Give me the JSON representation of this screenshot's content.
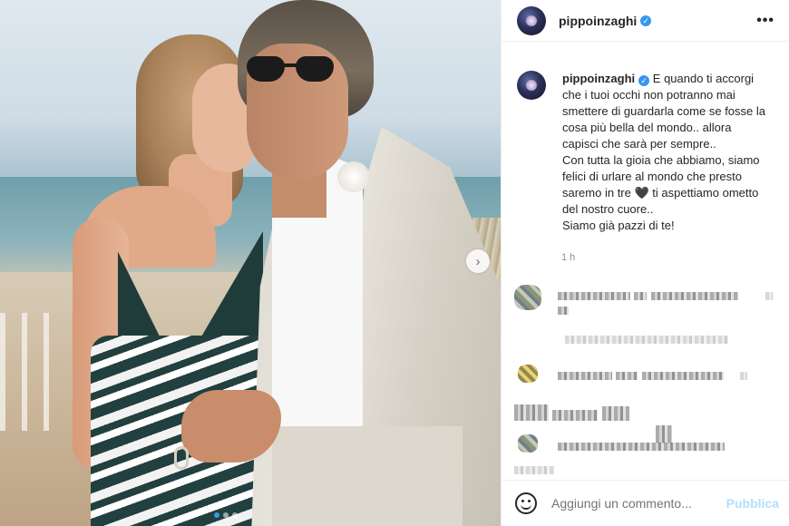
{
  "post": {
    "username": "pippoinzaghi",
    "verified_icon": "verified-badge-icon",
    "more_icon": "ellipsis-icon",
    "more_glyph": "•••",
    "caption_lines": [
      "E quando ti accorgi",
      "che i tuoi occhi non potranno mai",
      "smettere di guardarla come se fosse la",
      "cosa più bella del mondo.. allora",
      "capisci che sarà per sempre..",
      "Con tutta la gioia che abbiamo, siamo",
      "felici di urlare al mondo che presto",
      "saremo in tre 🖤 ti aspettiamo ometto",
      "del nostro cuore..",
      "Siamo già pazzi di te!"
    ],
    "time_ago": "1 h"
  },
  "carousel": {
    "next_glyph": "›",
    "slide_count": 3,
    "active_index": 0
  },
  "comment_box": {
    "placeholder": "Aggiungi un commento...",
    "publish_label": "Pubblica"
  },
  "colors": {
    "accent": "#3897f0",
    "publish_disabled": "#b2dffc",
    "secondary_text": "#8e8e8e"
  }
}
